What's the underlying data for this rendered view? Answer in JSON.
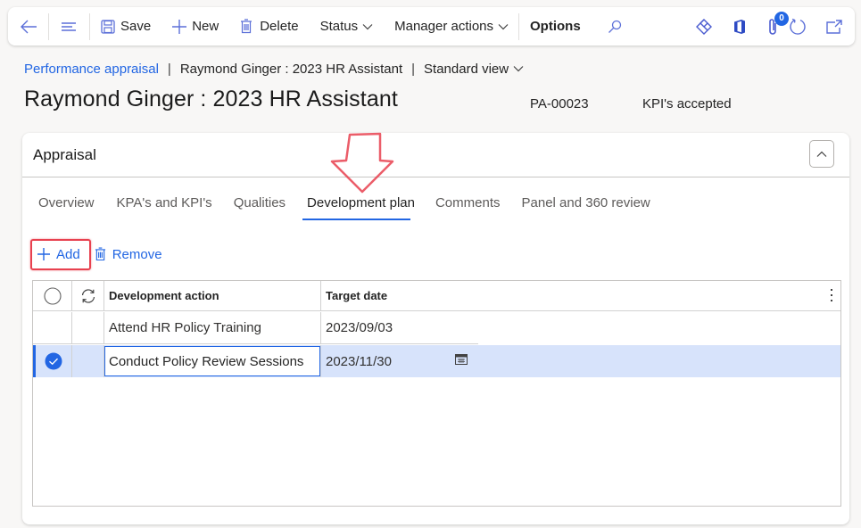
{
  "toolbar": {
    "back": "Back",
    "menu": "Menu",
    "save_label": "Save",
    "new_label": "New",
    "delete_label": "Delete",
    "status_label": "Status",
    "manager_actions_label": "Manager actions",
    "options_label": "Options",
    "attachments_count": "0"
  },
  "breadcrumb": {
    "root": "Performance appraisal",
    "separator": "|",
    "record": "Raymond Ginger : 2023 HR Assistant",
    "view": "Standard view"
  },
  "header": {
    "title": "Raymond Ginger : 2023 HR Assistant",
    "appraisal_id": "PA-00023",
    "status": "KPI's accepted"
  },
  "card": {
    "title": "Appraisal",
    "tabs": [
      {
        "label": "Overview",
        "active": false
      },
      {
        "label": "KPA's and KPI's",
        "active": false
      },
      {
        "label": "Qualities",
        "active": false
      },
      {
        "label": "Development plan",
        "active": true
      },
      {
        "label": "Comments",
        "active": false
      },
      {
        "label": "Panel and 360 review",
        "active": false
      }
    ],
    "actions": {
      "add_label": "Add",
      "remove_label": "Remove"
    },
    "grid": {
      "columns": [
        "Development action",
        "Target date"
      ],
      "rows": [
        {
          "development_action": "Attend HR Policy Training",
          "target_date": "2023/09/03",
          "selected": false
        },
        {
          "development_action": "Conduct Policy Review Sessions",
          "target_date": "2023/11/30",
          "selected": true
        }
      ]
    }
  },
  "colors": {
    "accent": "#2266e3",
    "selected_row": "#d7e3fb",
    "annotation": "#e8414f"
  }
}
